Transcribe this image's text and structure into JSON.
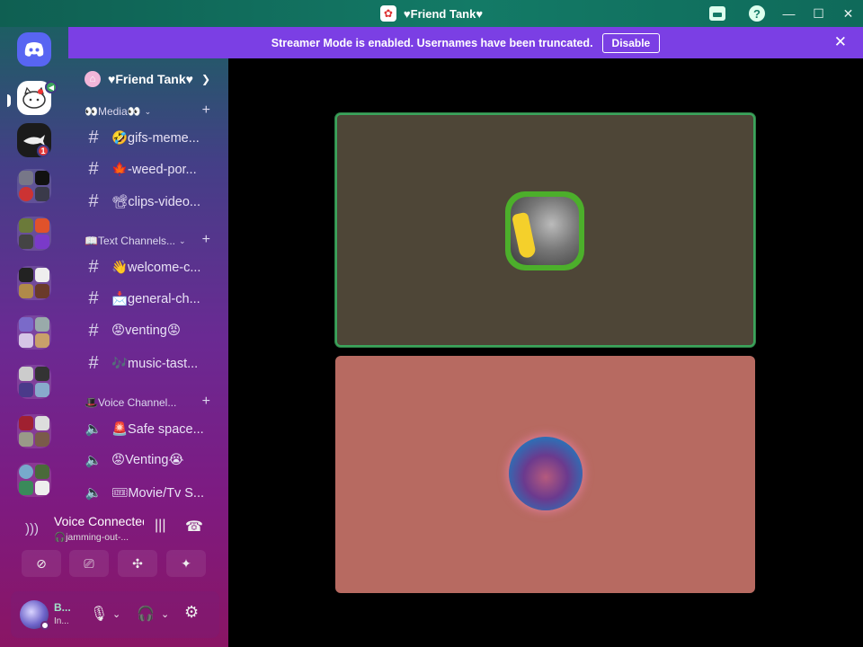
{
  "window": {
    "title": "♥Friend Tank♥",
    "app_icon": "hello-kitty-icon"
  },
  "banner": {
    "text": "Streamer Mode is enabled. Usernames have been truncated.",
    "button": "Disable"
  },
  "server": {
    "name": "♥Friend Tank♥"
  },
  "servers": [
    {
      "name": "discord-home-icon"
    },
    {
      "name": "friend-tank-server",
      "speaking": true
    },
    {
      "name": "shark-server",
      "badge": "1"
    },
    {
      "name": "server-folder-1"
    },
    {
      "name": "server-folder-2"
    },
    {
      "name": "server-folder-3"
    },
    {
      "name": "server-folder-4"
    },
    {
      "name": "server-folder-5"
    },
    {
      "name": "server-folder-6"
    },
    {
      "name": "server-folder-7"
    }
  ],
  "categories": [
    {
      "label": "👀Media👀",
      "channels": [
        {
          "label": "🤣gifs-meme...",
          "type": "text"
        },
        {
          "label": "🍁-weed-por...",
          "type": "text"
        },
        {
          "label": "📽clips-video...",
          "type": "text"
        }
      ]
    },
    {
      "label": "📖Text Channels...",
      "channels": [
        {
          "label": "👋welcome-c...",
          "type": "text"
        },
        {
          "label": "📩general-ch...",
          "type": "text"
        },
        {
          "label": "😡venting😡",
          "type": "text"
        },
        {
          "label": "🎶music-tast...",
          "type": "text"
        }
      ]
    },
    {
      "label": "🎩Voice Channel...",
      "channels": [
        {
          "label": "🚨Safe space...",
          "type": "voice"
        },
        {
          "label": "😡Venting😭",
          "type": "voice"
        },
        {
          "label": "🎟Movie/Tv S...",
          "type": "voice"
        }
      ]
    }
  ],
  "voice": {
    "title": "Voice Connected",
    "subtitle": "🎧jamming-out-..."
  },
  "user": {
    "name": "B...",
    "status": "In..."
  },
  "colors": {
    "banner": "#7b3fe4",
    "titlebar": "#137a66",
    "speaking_border": "#3ba55c",
    "tile1_bg": "#4e4637",
    "tile2_bg": "#b76a61"
  }
}
